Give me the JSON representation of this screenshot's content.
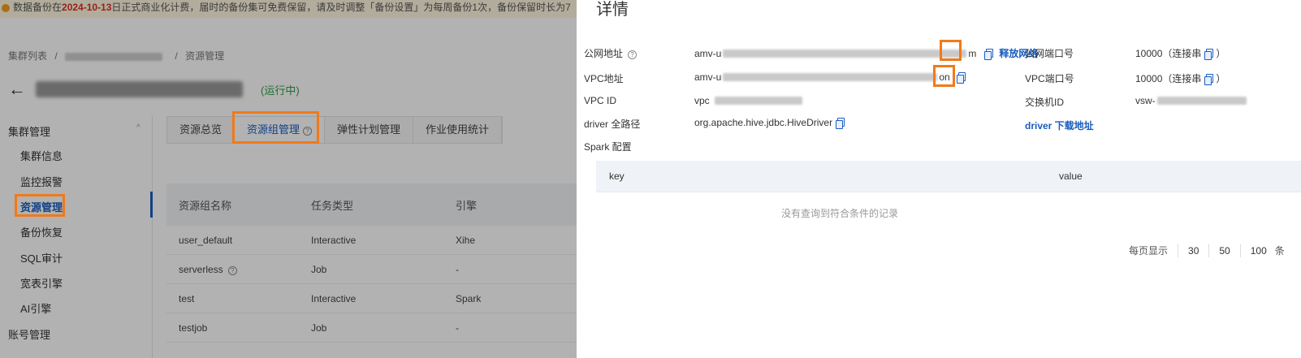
{
  "banner": {
    "prefix": "数据备份在",
    "date": "2024-10-13",
    "suffix": "日正式商业化计费，届时的备份集可免费保留，请及时调整「备份设置」为每周备份1次，备份保留时长为7"
  },
  "breadcrumb": {
    "root": "集群列表",
    "current": "资源管理"
  },
  "page": {
    "status": "(运行中)"
  },
  "sidebar": {
    "group_cluster": "集群管理",
    "items": [
      "集群信息",
      "监控报警",
      "资源管理",
      "备份恢复",
      "SQL审计",
      "宽表引擎",
      "AI引擎"
    ],
    "group_account": "账号管理"
  },
  "tabs": [
    "资源总览",
    "资源组管理",
    "弹性计划管理",
    "作业使用统计"
  ],
  "table": {
    "headers": [
      "资源组名称",
      "任务类型",
      "引擎"
    ],
    "rows": [
      {
        "name": "user_default",
        "type": "Interactive",
        "engine": "Xihe"
      },
      {
        "name": "serverless",
        "type": "Job",
        "engine": "-"
      },
      {
        "name": "test",
        "type": "Interactive",
        "engine": "Spark"
      },
      {
        "name": "testjob",
        "type": "Job",
        "engine": "-"
      }
    ]
  },
  "drawer": {
    "title": "详情",
    "public_addr_label": "公网地址",
    "public_addr_prefix": "amv-u",
    "public_addr_suffix": "m",
    "release_network": "释放网络",
    "vpc_addr_label": "VPC地址",
    "vpc_addr_prefix": "amv-u",
    "vpc_addr_suffix": "on",
    "vpc_id_label": "VPC ID",
    "vpc_id_prefix": "vpc",
    "driver_label": "driver 全路径",
    "driver_value": "org.apache.hive.jdbc.HiveDriver",
    "spark_label": "Spark 配置",
    "public_port_label": "公网端口号",
    "public_port_value": "10000（连接串",
    "public_port_close": "）",
    "vpc_port_label": "VPC端口号",
    "vpc_port_value": "10000（连接串",
    "vpc_port_close": "）",
    "vswitch_label": "交换机ID",
    "vswitch_prefix": "vsw-",
    "driver_download": "driver 下载地址",
    "spark_table": {
      "key_header": "key",
      "value_header": "value",
      "empty_text": "没有查询到符合条件的记录"
    },
    "pager": {
      "label": "每页显示",
      "sizes": [
        "30",
        "50",
        "100"
      ],
      "tail": "条"
    }
  },
  "colors": {
    "accent": "#1a5dbf",
    "highlight": "#f07a1a",
    "running": "#2e9b4a"
  }
}
